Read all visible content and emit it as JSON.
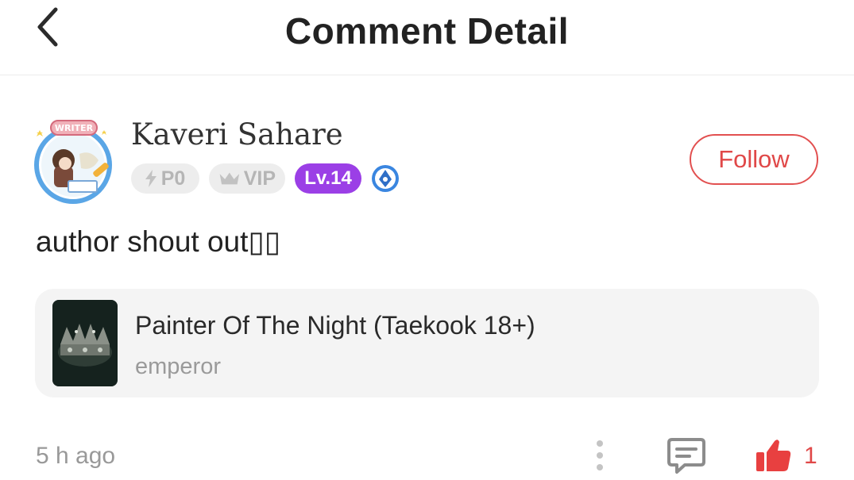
{
  "header": {
    "title": "Comment Detail",
    "back_icon": "chevron-left-icon"
  },
  "user": {
    "name": "Kaveri Sahare",
    "avatar_badge": "WRITER",
    "badges": {
      "power": "P0",
      "vip": "VIP",
      "level": "Lv.14"
    },
    "level_color": "#9b3fe6",
    "follow_label": "Follow"
  },
  "comment": {
    "text": "author shout out▯▯"
  },
  "book": {
    "title": "Painter Of The Night (Taekook 18+)",
    "subtitle": "emperor"
  },
  "footer": {
    "time": "5 h ago",
    "likes": "1"
  },
  "colors": {
    "accent": "#e04848",
    "card_bg": "#f4f4f4"
  }
}
